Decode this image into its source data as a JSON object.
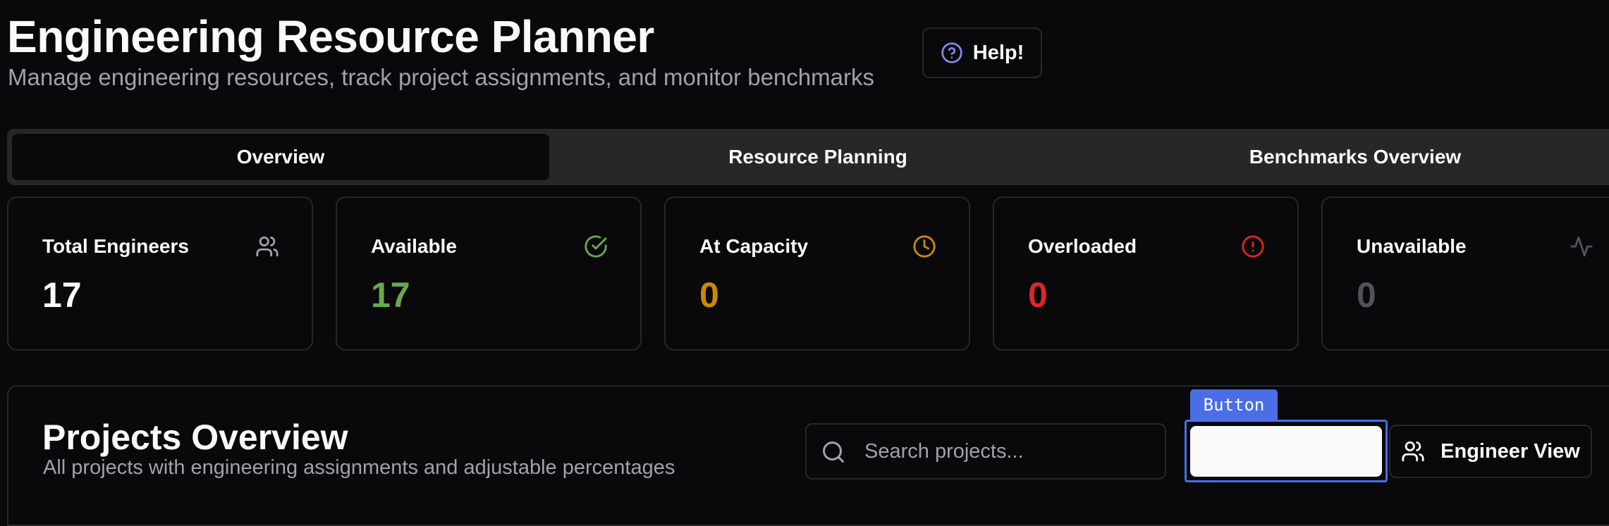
{
  "header": {
    "title": "Engineering Resource Planner",
    "subtitle": "Manage engineering resources, track project assignments, and monitor benchmarks",
    "help_label": "Help!"
  },
  "tabs": [
    {
      "label": "Overview",
      "active": true
    },
    {
      "label": "Resource Planning",
      "active": false
    },
    {
      "label": "Benchmarks Overview",
      "active": false
    }
  ],
  "stats": [
    {
      "label": "Total Engineers",
      "value": "17",
      "icon": "users-icon",
      "color": "#fafafa"
    },
    {
      "label": "Available",
      "value": "17",
      "icon": "check-circle-icon",
      "color": "#6aa84f"
    },
    {
      "label": "At Capacity",
      "value": "0",
      "icon": "clock-icon",
      "color": "#ca8a04"
    },
    {
      "label": "Overloaded",
      "value": "0",
      "icon": "alert-circle-icon",
      "color": "#dc2626"
    },
    {
      "label": "Unavailable",
      "value": "0",
      "icon": "activity-icon",
      "color": "#52525b"
    }
  ],
  "projects": {
    "title": "Projects Overview",
    "subtitle": "All projects with engineering assignments and adjustable percentages",
    "search_placeholder": "Search projects...",
    "tooltip": "Button",
    "engineer_view_label": "Engineer View"
  }
}
